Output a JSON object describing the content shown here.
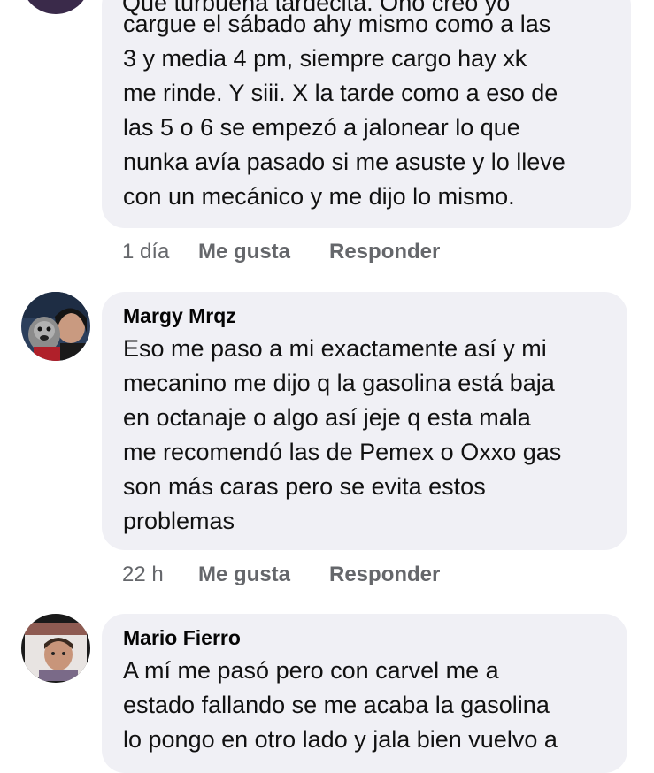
{
  "comments": [
    {
      "author": "",
      "partial_top_line": "Que turbuena tardecita. Ono creo yo",
      "text": "cargue el sábado ahy mismo como a las\n3 y media 4 pm, siempre cargo hay xk\nme rinde. Y siii. X la tarde como a eso de\nlas 5 o 6 se empezó a jalonear lo que\nnunka avía pasado si me asuste y lo lleve\ncon un mecánico y me dijo lo mismo.",
      "time": "1 día",
      "like": "Me gusta",
      "reply": "Responder"
    },
    {
      "author": "Margy Mrqz",
      "text": "Eso me paso a mi exactamente así y mi\nmecanino me dijo q la gasolina está baja\nen octanaje o algo así jeje q esta mala\nme recomendó las de Pemex o Oxxo gas\nson más caras pero se evita estos\nproblemas",
      "time": "22 h",
      "like": "Me gusta",
      "reply": "Responder"
    },
    {
      "author": "Mario Fierro",
      "text": "A mí me pasó pero con carvel me a\nestado fallando se me acaba la gasolina\nlo pongo en otro lado y jala bien vuelvo a",
      "time": "",
      "like": "",
      "reply": ""
    }
  ],
  "colors": {
    "bubble": "#f0f0f5",
    "meta": "#65676b",
    "text": "#050505"
  }
}
